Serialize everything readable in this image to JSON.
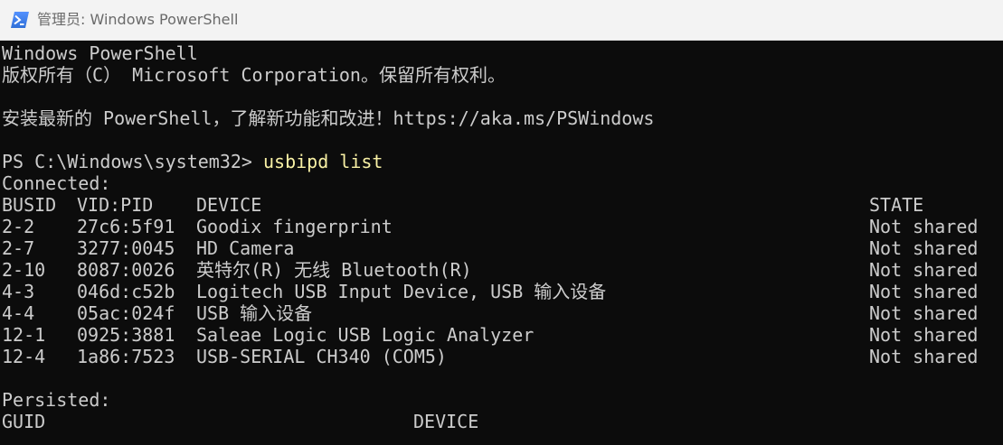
{
  "window": {
    "title": "管理员: Windows PowerShell",
    "icon": "powershell-icon",
    "titlebar_color": "#f3f3f3",
    "background_color": "#0c0c0c",
    "text_color": "#cccccc",
    "command_color": "#f9f1a5"
  },
  "console": {
    "banner_line1": "Windows PowerShell",
    "banner_line2": "版权所有（C） Microsoft Corporation。保留所有权利。",
    "banner_line3": "安装最新的 PowerShell，了解新功能和改进！https://aka.ms/PSWindows",
    "prompt": "PS C:\\Windows\\system32> ",
    "command": "usbipd list",
    "connected_label": "Connected:",
    "connected_headers": {
      "busid": "BUSID",
      "vidpid": "VID:PID",
      "device": "DEVICE",
      "state": "STATE"
    },
    "connected_rows": [
      {
        "busid": "2-2",
        "vidpid": "27c6:5f91",
        "device": "Goodix fingerprint",
        "state": "Not shared"
      },
      {
        "busid": "2-7",
        "vidpid": "3277:0045",
        "device": "HD Camera",
        "state": "Not shared"
      },
      {
        "busid": "2-10",
        "vidpid": "8087:0026",
        "device": "英特尔(R) 无线 Bluetooth(R)",
        "state": "Not shared"
      },
      {
        "busid": "4-3",
        "vidpid": "046d:c52b",
        "device": "Logitech USB Input Device, USB 输入设备",
        "state": "Not shared"
      },
      {
        "busid": "4-4",
        "vidpid": "05ac:024f",
        "device": "USB 输入设备",
        "state": "Not shared"
      },
      {
        "busid": "12-1",
        "vidpid": "0925:3881",
        "device": "Saleae Logic USB Logic Analyzer",
        "state": "Not shared"
      },
      {
        "busid": "12-4",
        "vidpid": "1a86:7523",
        "device": "USB-SERIAL CH340 (COM5)",
        "state": "Not shared"
      }
    ],
    "persisted_label": "Persisted:",
    "persisted_headers": {
      "guid": "GUID",
      "device": "DEVICE"
    }
  }
}
